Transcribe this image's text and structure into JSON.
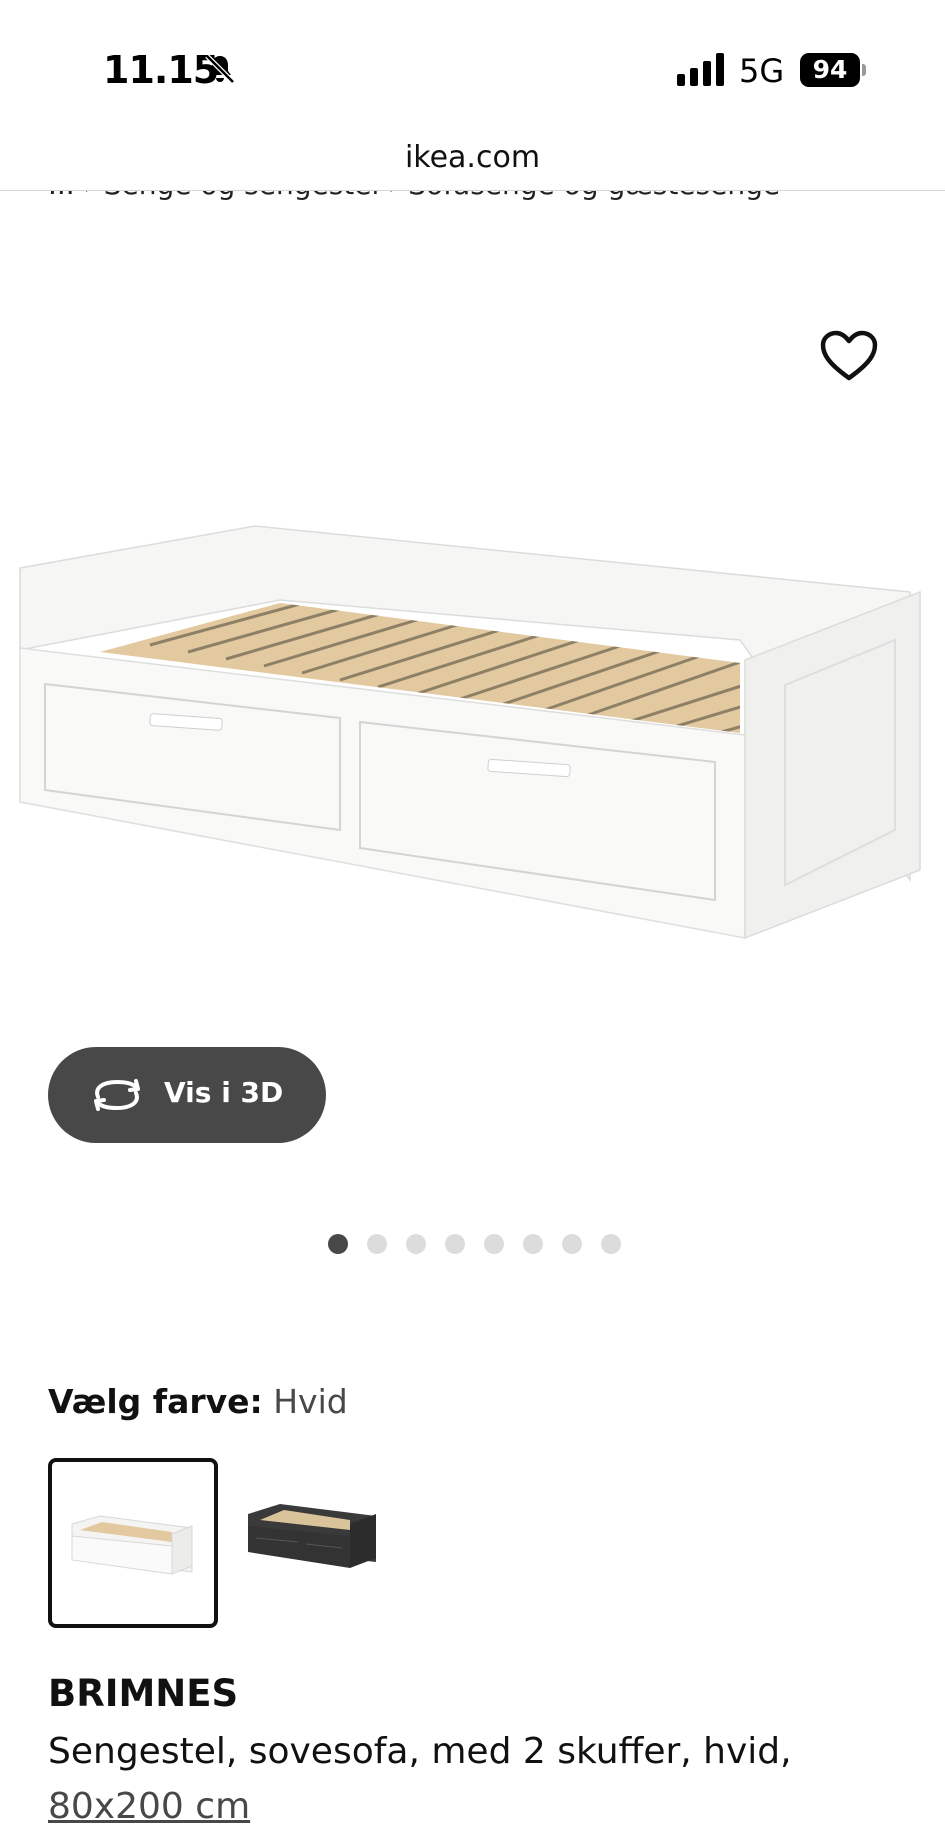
{
  "status_bar": {
    "time": "11.15",
    "network": "5G",
    "battery": "94",
    "icons": [
      "bell-muted-icon",
      "signal-icon",
      "battery-icon"
    ]
  },
  "browser": {
    "url": "ikea.com"
  },
  "breadcrumb": {
    "text": "... › Senge og sengestel › Sofasenge og gæstesenge"
  },
  "gallery": {
    "wishlist_icon": "heart-icon",
    "view_3d_label": "Vis i 3D",
    "view_3d_icon": "rotate-3d-icon",
    "image_count": 8,
    "active_index": 0
  },
  "color_selector": {
    "label": "Vælg farve:",
    "selected": "Hvid",
    "options": [
      "Hvid",
      "Sort"
    ]
  },
  "product": {
    "name": "BRIMNES",
    "description": "Sengestel, sovesofa, med 2 skuffer, hvid,",
    "size": "80x200 cm"
  },
  "colors": {
    "button_bg": "#484848",
    "dot_active": "#484848",
    "dot_inactive": "#dcdcdc",
    "slats": "#e3c99f",
    "bed_white": "#f4f4f2",
    "bed_dark": "#3a3a3a"
  }
}
